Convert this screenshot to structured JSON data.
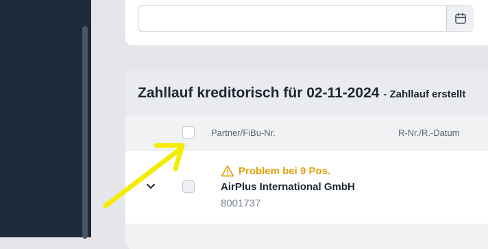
{
  "filter": {
    "date_value": "",
    "calendar_icon": "calendar-icon"
  },
  "card": {
    "title": "Zahllauf kreditorisch für 02-11-2024",
    "status": "- Zahllauf erstellt"
  },
  "table": {
    "columns": [
      "Partner/FiBu-Nr.",
      "R-Nr./R.-Datum"
    ],
    "rows": [
      {
        "warning": "Problem bei 9 Pos.",
        "partner": "AirPlus International GmbH",
        "fibu_nr": "8001737"
      }
    ]
  },
  "colors": {
    "sidebar": "#1f2a3a",
    "warning": "#e3a008",
    "annotation_arrow": "#f5ec00"
  }
}
